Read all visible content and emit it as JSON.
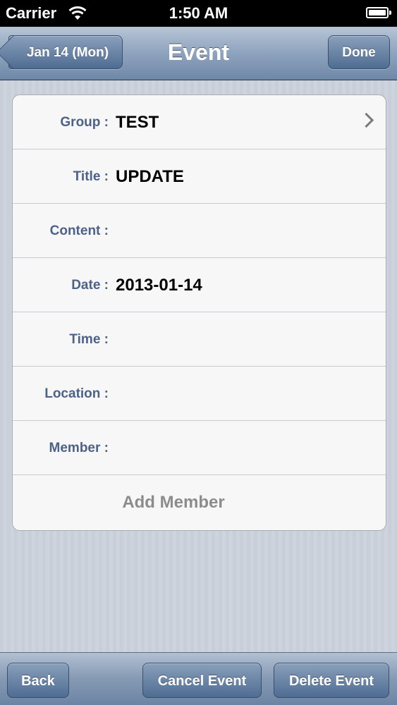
{
  "status_bar": {
    "carrier": "Carrier",
    "time": "1:50 AM",
    "icons": [
      "wifi-icon",
      "battery-icon"
    ]
  },
  "nav_bar": {
    "back_label": "Jan 14 (Mon)",
    "title": "Event",
    "done_label": "Done"
  },
  "form": {
    "rows": [
      {
        "label": "Group :",
        "value": "TEST"
      },
      {
        "label": "Title :",
        "value": "UPDATE"
      },
      {
        "label": "Content :",
        "value": ""
      },
      {
        "label": "Date :",
        "value": "2013-01-14"
      },
      {
        "label": "Time :",
        "value": ""
      },
      {
        "label": "Location :",
        "value": ""
      },
      {
        "label": "Member :",
        "value": ""
      }
    ],
    "add_member_label": "Add Member"
  },
  "toolbar": {
    "back_label": "Back",
    "cancel_label": "Cancel Event",
    "delete_label": "Delete Event"
  },
  "colors": {
    "label_text": "#4c6286",
    "nav_tint": "#6f88a8"
  }
}
